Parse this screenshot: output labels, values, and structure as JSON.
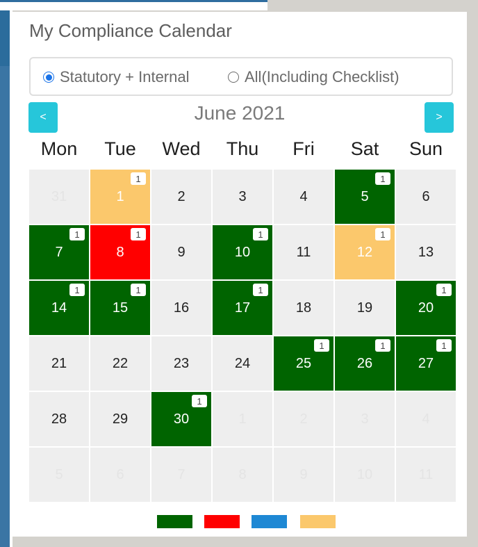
{
  "title": "My Compliance Calendar",
  "filter": {
    "options": [
      {
        "label": "Statutory + Internal",
        "checked": true
      },
      {
        "label": "All(Including Checklist)",
        "checked": false
      }
    ]
  },
  "nav": {
    "prev": "<",
    "next": ">",
    "month": "June 2021"
  },
  "weekdays": [
    "Mon",
    "Tue",
    "Wed",
    "Thu",
    "Fri",
    "Sat",
    "Sun"
  ],
  "days": [
    {
      "n": "31",
      "other": true
    },
    {
      "n": "1",
      "status": "yellow",
      "badge": "1"
    },
    {
      "n": "2"
    },
    {
      "n": "3"
    },
    {
      "n": "4"
    },
    {
      "n": "5",
      "status": "green",
      "badge": "1"
    },
    {
      "n": "6"
    },
    {
      "n": "7",
      "status": "green",
      "badge": "1"
    },
    {
      "n": "8",
      "status": "red",
      "badge": "1"
    },
    {
      "n": "9"
    },
    {
      "n": "10",
      "status": "green",
      "badge": "1"
    },
    {
      "n": "11"
    },
    {
      "n": "12",
      "status": "yellow",
      "badge": "1"
    },
    {
      "n": "13"
    },
    {
      "n": "14",
      "status": "green",
      "badge": "1"
    },
    {
      "n": "15",
      "status": "green",
      "badge": "1"
    },
    {
      "n": "16"
    },
    {
      "n": "17",
      "status": "green",
      "badge": "1"
    },
    {
      "n": "18"
    },
    {
      "n": "19"
    },
    {
      "n": "20",
      "status": "green",
      "badge": "1"
    },
    {
      "n": "21"
    },
    {
      "n": "22"
    },
    {
      "n": "23"
    },
    {
      "n": "24"
    },
    {
      "n": "25",
      "status": "green",
      "badge": "1"
    },
    {
      "n": "26",
      "status": "green",
      "badge": "1"
    },
    {
      "n": "27",
      "status": "green",
      "badge": "1"
    },
    {
      "n": "28"
    },
    {
      "n": "29"
    },
    {
      "n": "30",
      "status": "green",
      "badge": "1"
    },
    {
      "n": "1",
      "other": true
    },
    {
      "n": "2",
      "other": true
    },
    {
      "n": "3",
      "other": true
    },
    {
      "n": "4",
      "other": true
    },
    {
      "n": "5",
      "other": true
    },
    {
      "n": "6",
      "other": true
    },
    {
      "n": "7",
      "other": true
    },
    {
      "n": "8",
      "other": true
    },
    {
      "n": "9",
      "other": true
    },
    {
      "n": "10",
      "other": true
    },
    {
      "n": "11",
      "other": true
    }
  ],
  "legend": [
    {
      "key": "green",
      "color": "#006400"
    },
    {
      "key": "red",
      "color": "#ff0000"
    },
    {
      "key": "blue",
      "color": "#1e88d4"
    },
    {
      "key": "yellow",
      "color": "#fbc86c"
    }
  ]
}
